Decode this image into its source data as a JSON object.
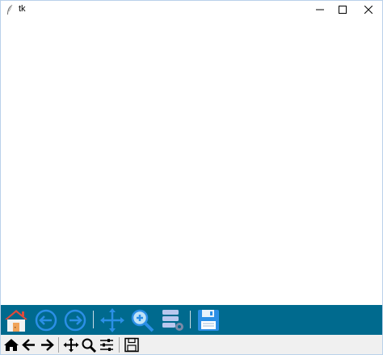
{
  "window": {
    "title": "tk",
    "title_icon": "tk-feather-icon",
    "controls": [
      "minimize-icon",
      "maximize-icon",
      "close-icon"
    ]
  },
  "toolbar_primary": {
    "background": "#006a8e",
    "buttons": [
      "home-icon",
      "back-icon",
      "forward-icon",
      "pan-icon",
      "zoom-icon",
      "subplots-icon",
      "save-icon"
    ]
  },
  "toolbar_secondary": {
    "buttons": [
      "home-icon",
      "back-icon",
      "forward-icon",
      "pan-icon",
      "zoom-icon",
      "configure-icon",
      "save-icon"
    ]
  }
}
